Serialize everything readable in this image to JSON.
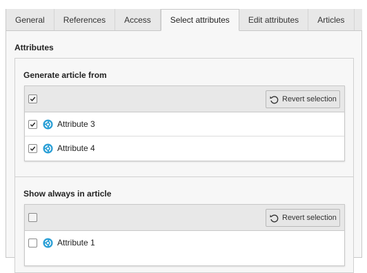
{
  "tabs": [
    {
      "label": "General",
      "active": false
    },
    {
      "label": "References",
      "active": false
    },
    {
      "label": "Access",
      "active": false
    },
    {
      "label": "Select attributes",
      "active": true
    },
    {
      "label": "Edit attributes",
      "active": false
    },
    {
      "label": "Articles",
      "active": false
    }
  ],
  "panel": {
    "title": "Attributes",
    "generate": {
      "title": "Generate article from",
      "header_checked": true,
      "revert_label": "Revert selection",
      "rows": [
        {
          "label": "Attribute 3",
          "checked": true,
          "icon": "attribute-icon"
        },
        {
          "label": "Attribute 4",
          "checked": true,
          "icon": "attribute-icon"
        }
      ]
    },
    "always": {
      "title": "Show always in article",
      "header_checked": false,
      "revert_label": "Revert selection",
      "rows": [
        {
          "label": "Attribute 1",
          "checked": false,
          "icon": "attribute-icon"
        }
      ]
    }
  },
  "colors": {
    "tab_bg": "#e8e8e8",
    "panel_bg": "#f7f7f7",
    "border": "#c8c8c8",
    "attr_icon": "#2a9fd6"
  }
}
